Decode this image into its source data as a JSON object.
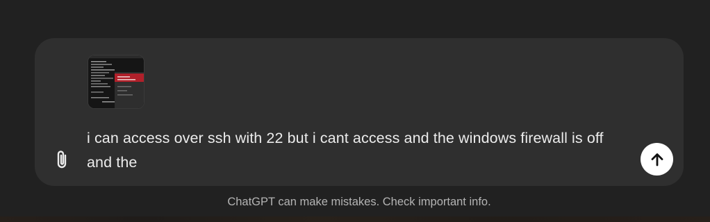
{
  "composer": {
    "message_text": "i can access over ssh with 22 but i cant access  and the windows firewall is off and the",
    "attachment_icon": "paperclip-icon",
    "send_icon": "arrow-up-icon",
    "image_attachment": "terminal-screenshot-thumbnail"
  },
  "footer": {
    "disclaimer": "ChatGPT can make mistakes. Check important info."
  },
  "colors": {
    "page_bg": "#212121",
    "composer_bg": "#2f2f2f",
    "text": "#ececec",
    "muted_text": "#b4b4b4",
    "send_button_bg": "#ffffff"
  }
}
